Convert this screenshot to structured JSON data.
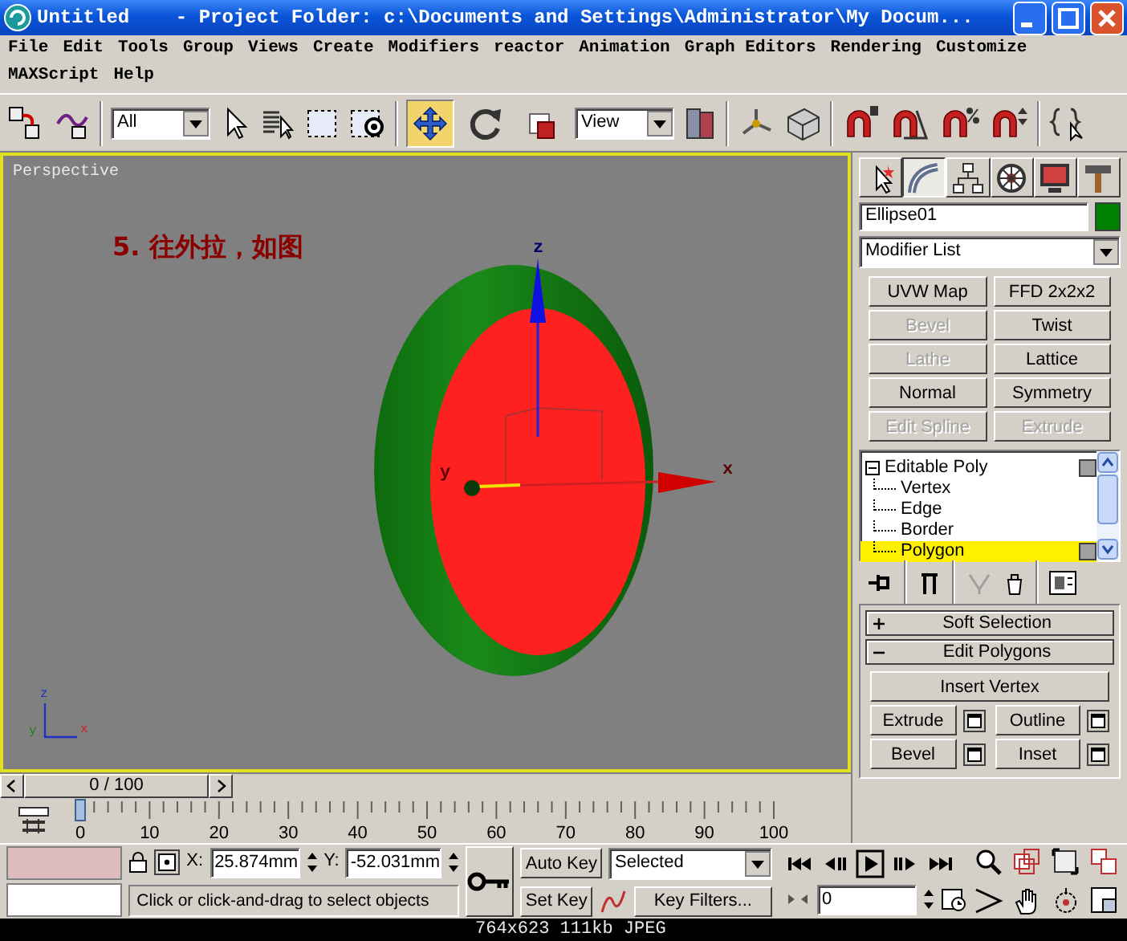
{
  "window": {
    "title": "Untitled    - Project Folder: c:\\Documents and Settings\\Administrator\\My Docum..."
  },
  "menu": [
    "File",
    "Edit",
    "Tools",
    "Group",
    "Views",
    "Create",
    "Modifiers",
    "reactor",
    "Animation",
    "Graph Editors",
    "Rendering",
    "Customize",
    "MAXScript",
    "Help"
  ],
  "toolbar": {
    "selection_filter": "All",
    "reference_coordinate_system": "View",
    "transform_tools": [
      {
        "selected": true
      },
      {
        "selected": false
      },
      {
        "selected": false
      }
    ]
  },
  "viewport": {
    "label": "Perspective",
    "annotation": "5. 往外拉，如图",
    "gizmo_labels": [
      "z",
      "y",
      "x"
    ],
    "axis_tripod_labels": [
      "z",
      "y",
      "x"
    ]
  },
  "command_panel": {
    "tabs": [
      {
        "selected": false
      },
      {
        "selected": true
      },
      {
        "selected": false
      },
      {
        "selected": false
      },
      {
        "selected": false
      },
      {
        "selected": false
      }
    ],
    "object_name": "Ellipse01",
    "modifier_list": "Modifier List",
    "modifier_buttons": [
      {
        "label": "UVW Map",
        "disabled": false
      },
      {
        "label": "FFD 2x2x2",
        "disabled": false
      },
      {
        "label": "Bevel",
        "disabled": true
      },
      {
        "label": "Twist",
        "disabled": false
      },
      {
        "label": "Lathe",
        "disabled": true
      },
      {
        "label": "Lattice",
        "disabled": false
      },
      {
        "label": "Normal",
        "disabled": false
      },
      {
        "label": "Symmetry",
        "disabled": false
      },
      {
        "label": "Edit Spline",
        "disabled": true
      },
      {
        "label": "Extrude",
        "disabled": true
      }
    ],
    "stack": [
      {
        "label": "Editable Poly",
        "expanded": true,
        "selected": false,
        "children": [
          {
            "label": "Vertex",
            "selected": false
          },
          {
            "label": "Edge",
            "selected": false
          },
          {
            "label": "Border",
            "selected": false
          },
          {
            "label": "Polygon",
            "selected": true
          }
        ]
      }
    ],
    "rollouts": [
      {
        "label": "Soft Selection",
        "expanded": false
      },
      {
        "label": "Edit Polygons",
        "expanded": true,
        "buttons": [
          {
            "label": "Insert Vertex",
            "kind": "wide"
          },
          {
            "label": "Extrude",
            "kind": "settings"
          },
          {
            "label": "Outline",
            "kind": "settings"
          },
          {
            "label": "Bevel",
            "kind": "settings"
          },
          {
            "label": "Inset",
            "kind": "settings"
          }
        ]
      }
    ]
  },
  "time_slider": {
    "label": "0 / 100",
    "level": 0
  },
  "ruler": {
    "labels": [
      "0",
      "10",
      "20",
      "30",
      "40",
      "50",
      "60",
      "70",
      "80",
      "90",
      "100"
    ]
  },
  "status": {
    "x_label": "X:",
    "x": "25.874mm",
    "y_label": "Y:",
    "y": "-52.031mm",
    "prompt": "Click or click-and-drag to select objects",
    "auto_key": "Auto Key",
    "key_mode": "Selected",
    "set_key": "Set Key",
    "key_filters": "Key Filters...",
    "frame": "0"
  },
  "image_info": "764x623 111kb JPEG"
}
